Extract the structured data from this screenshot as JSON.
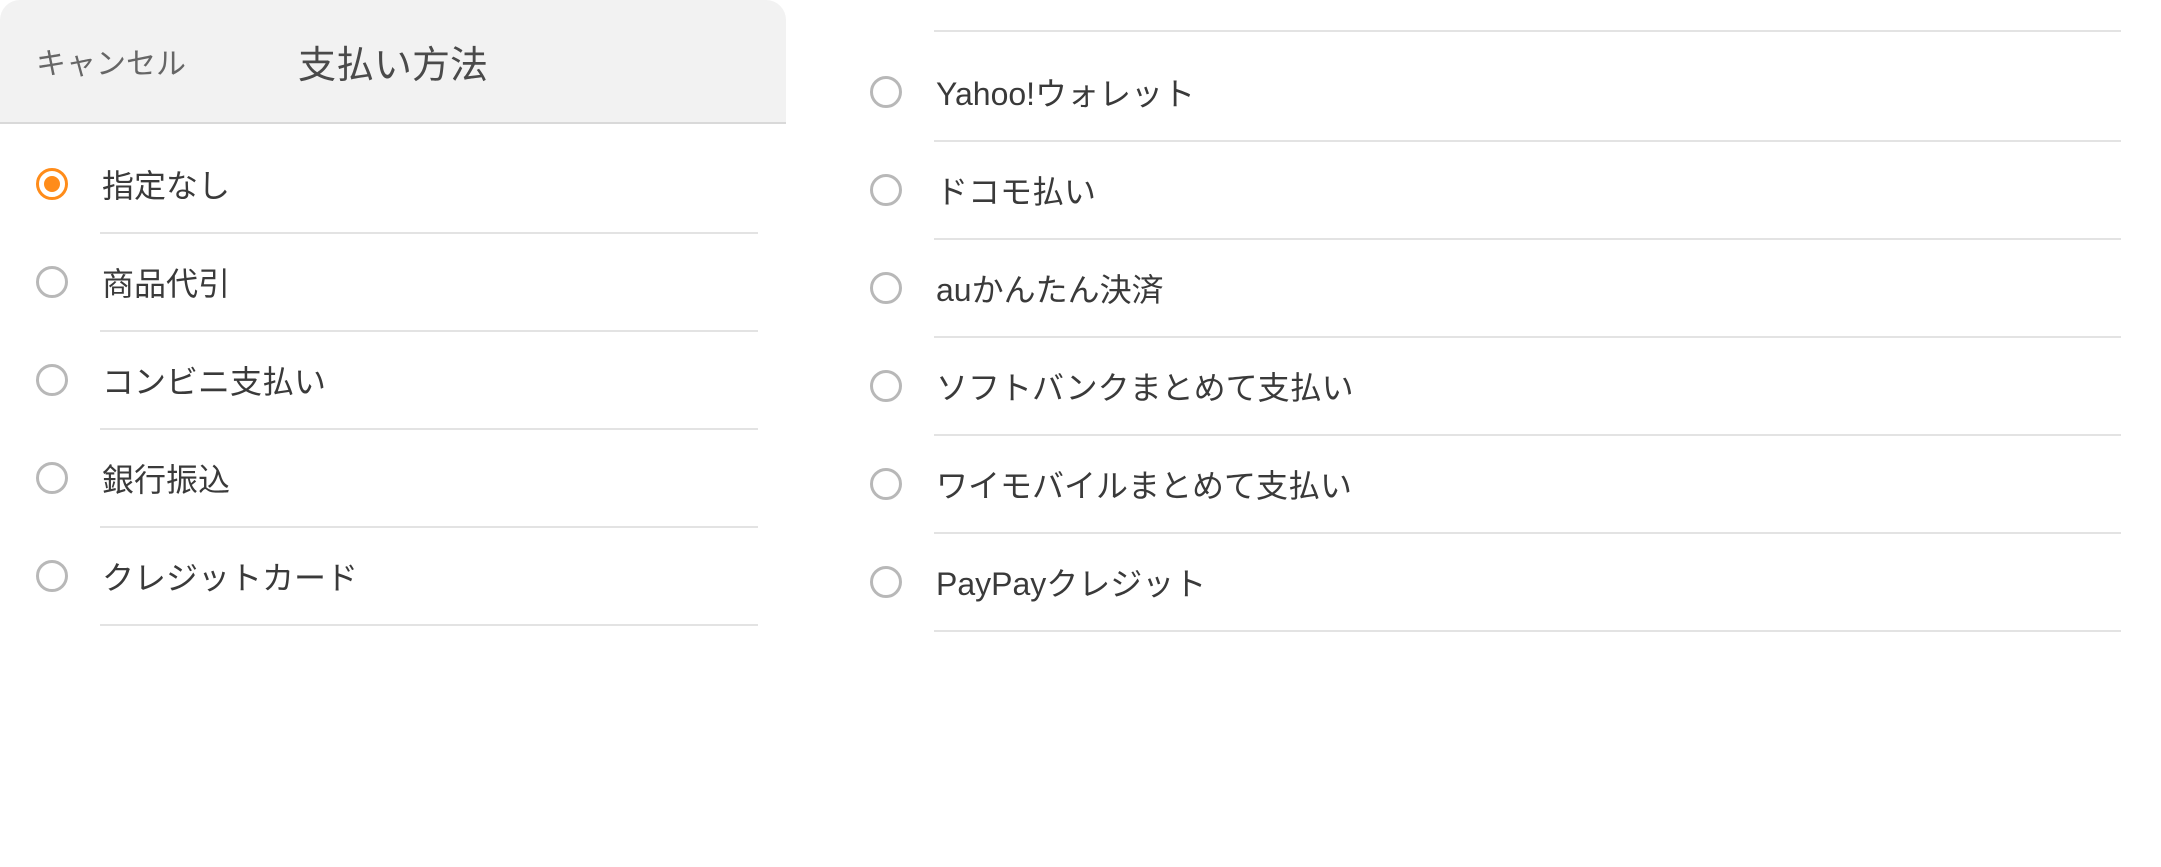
{
  "header": {
    "cancel_label": "キャンセル",
    "title": "支払い方法"
  },
  "left_options": [
    {
      "label": "指定なし",
      "selected": true
    },
    {
      "label": "商品代引",
      "selected": false
    },
    {
      "label": "コンビニ支払い",
      "selected": false
    },
    {
      "label": "銀行振込",
      "selected": false
    },
    {
      "label": "クレジットカード",
      "selected": false
    }
  ],
  "right_options": [
    {
      "label": "Yahoo!ウォレット",
      "selected": false
    },
    {
      "label": "ドコモ払い",
      "selected": false
    },
    {
      "label": "auかんたん決済",
      "selected": false
    },
    {
      "label": "ソフトバンクまとめて支払い",
      "selected": false
    },
    {
      "label": "ワイモバイルまとめて支払い",
      "selected": false
    },
    {
      "label": "PayPayクレジット",
      "selected": false
    }
  ]
}
